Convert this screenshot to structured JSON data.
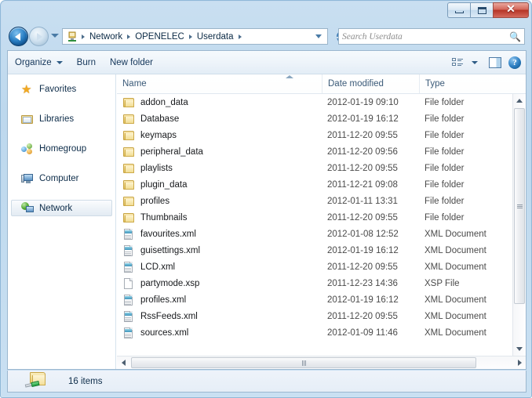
{
  "window": {
    "caption_buttons": [
      {
        "name": "minimize",
        "label": "–"
      },
      {
        "name": "maximize",
        "label": "□"
      },
      {
        "name": "close",
        "label": "✕"
      }
    ]
  },
  "address": {
    "computer_icon": "network-computer-icon",
    "crumbs": [
      "Network",
      "OPENELEC",
      "Userdata"
    ],
    "dropdown_icon": "chevron-down-icon",
    "refresh_icon": "refresh-icon",
    "back_icon": "back-arrow-icon",
    "forward_icon": "forward-arrow-icon"
  },
  "search": {
    "placeholder": "Search Userdata",
    "value": "",
    "icon": "search-icon"
  },
  "toolbar": {
    "organize_label": "Organize",
    "burn_label": "Burn",
    "new_folder_label": "New folder",
    "views_icon": "view-list-icon",
    "views_caret_icon": "chevron-down-icon",
    "preview_pane_icon": "preview-pane-icon",
    "help_icon": "help-icon"
  },
  "sidebar": {
    "items": [
      {
        "label": "Favorites",
        "icon": "star-icon",
        "selected": false
      },
      {
        "label": "Libraries",
        "icon": "libraries-icon",
        "selected": false
      },
      {
        "label": "Homegroup",
        "icon": "homegroup-icon",
        "selected": false
      },
      {
        "label": "Computer",
        "icon": "computer-icon",
        "selected": false
      },
      {
        "label": "Network",
        "icon": "network-icon",
        "selected": true
      }
    ]
  },
  "filelist": {
    "columns": [
      {
        "key": "name",
        "label": "Name",
        "sorted": "asc"
      },
      {
        "key": "date",
        "label": "Date modified",
        "sorted": ""
      },
      {
        "key": "type",
        "label": "Type",
        "sorted": ""
      }
    ],
    "sort_indicator_icon": "sort-ascending-icon",
    "rows": [
      {
        "name": "addon_data",
        "date": "2012-01-19 09:10",
        "type": "File folder",
        "icon": "folder-icon"
      },
      {
        "name": "Database",
        "date": "2012-01-19 16:12",
        "type": "File folder",
        "icon": "folder-icon"
      },
      {
        "name": "keymaps",
        "date": "2011-12-20 09:55",
        "type": "File folder",
        "icon": "folder-icon"
      },
      {
        "name": "peripheral_data",
        "date": "2011-12-20 09:56",
        "type": "File folder",
        "icon": "folder-icon"
      },
      {
        "name": "playlists",
        "date": "2011-12-20 09:55",
        "type": "File folder",
        "icon": "folder-icon"
      },
      {
        "name": "plugin_data",
        "date": "2011-12-21 09:08",
        "type": "File folder",
        "icon": "folder-icon"
      },
      {
        "name": "profiles",
        "date": "2012-01-11 13:31",
        "type": "File folder",
        "icon": "folder-icon"
      },
      {
        "name": "Thumbnails",
        "date": "2011-12-20 09:55",
        "type": "File folder",
        "icon": "folder-icon"
      },
      {
        "name": "favourites.xml",
        "date": "2012-01-08 12:52",
        "type": "XML Document",
        "icon": "xml-file-icon"
      },
      {
        "name": "guisettings.xml",
        "date": "2012-01-19 16:12",
        "type": "XML Document",
        "icon": "xml-file-icon"
      },
      {
        "name": "LCD.xml",
        "date": "2011-12-20 09:55",
        "type": "XML Document",
        "icon": "xml-file-icon"
      },
      {
        "name": "partymode.xsp",
        "date": "2011-12-23 14:36",
        "type": "XSP File",
        "icon": "generic-file-icon"
      },
      {
        "name": "profiles.xml",
        "date": "2012-01-19 16:12",
        "type": "XML Document",
        "icon": "xml-file-icon"
      },
      {
        "name": "RssFeeds.xml",
        "date": "2011-12-20 09:55",
        "type": "XML Document",
        "icon": "xml-file-icon"
      },
      {
        "name": "sources.xml",
        "date": "2012-01-09 11:46",
        "type": "XML Document",
        "icon": "xml-file-icon"
      }
    ]
  },
  "scrollbars": {
    "v_up_icon": "triangle-up-icon",
    "v_down_icon": "triangle-down-icon",
    "h_left_icon": "triangle-left-icon",
    "h_right_icon": "triangle-right-icon"
  },
  "status": {
    "text": "16 items",
    "icon": "shared-network-folder-icon"
  },
  "colors": {
    "glass": "#c5dcef",
    "accent": "#2a7fc4",
    "close_button": "#b53426",
    "folder": "#ecd078",
    "selection_border": "#cfdce7"
  }
}
